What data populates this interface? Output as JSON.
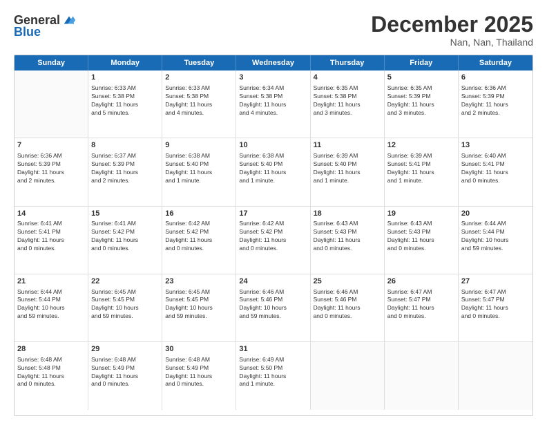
{
  "header": {
    "logo_line1": "General",
    "logo_line2": "Blue",
    "month": "December 2025",
    "location": "Nan, Nan, Thailand"
  },
  "days_of_week": [
    "Sunday",
    "Monday",
    "Tuesday",
    "Wednesday",
    "Thursday",
    "Friday",
    "Saturday"
  ],
  "weeks": [
    [
      {
        "day": "",
        "info": ""
      },
      {
        "day": "1",
        "info": "Sunrise: 6:33 AM\nSunset: 5:38 PM\nDaylight: 11 hours\nand 5 minutes."
      },
      {
        "day": "2",
        "info": "Sunrise: 6:33 AM\nSunset: 5:38 PM\nDaylight: 11 hours\nand 4 minutes."
      },
      {
        "day": "3",
        "info": "Sunrise: 6:34 AM\nSunset: 5:38 PM\nDaylight: 11 hours\nand 4 minutes."
      },
      {
        "day": "4",
        "info": "Sunrise: 6:35 AM\nSunset: 5:38 PM\nDaylight: 11 hours\nand 3 minutes."
      },
      {
        "day": "5",
        "info": "Sunrise: 6:35 AM\nSunset: 5:39 PM\nDaylight: 11 hours\nand 3 minutes."
      },
      {
        "day": "6",
        "info": "Sunrise: 6:36 AM\nSunset: 5:39 PM\nDaylight: 11 hours\nand 2 minutes."
      }
    ],
    [
      {
        "day": "7",
        "info": "Sunrise: 6:36 AM\nSunset: 5:39 PM\nDaylight: 11 hours\nand 2 minutes."
      },
      {
        "day": "8",
        "info": "Sunrise: 6:37 AM\nSunset: 5:39 PM\nDaylight: 11 hours\nand 2 minutes."
      },
      {
        "day": "9",
        "info": "Sunrise: 6:38 AM\nSunset: 5:40 PM\nDaylight: 11 hours\nand 1 minute."
      },
      {
        "day": "10",
        "info": "Sunrise: 6:38 AM\nSunset: 5:40 PM\nDaylight: 11 hours\nand 1 minute."
      },
      {
        "day": "11",
        "info": "Sunrise: 6:39 AM\nSunset: 5:40 PM\nDaylight: 11 hours\nand 1 minute."
      },
      {
        "day": "12",
        "info": "Sunrise: 6:39 AM\nSunset: 5:41 PM\nDaylight: 11 hours\nand 1 minute."
      },
      {
        "day": "13",
        "info": "Sunrise: 6:40 AM\nSunset: 5:41 PM\nDaylight: 11 hours\nand 0 minutes."
      }
    ],
    [
      {
        "day": "14",
        "info": "Sunrise: 6:41 AM\nSunset: 5:41 PM\nDaylight: 11 hours\nand 0 minutes."
      },
      {
        "day": "15",
        "info": "Sunrise: 6:41 AM\nSunset: 5:42 PM\nDaylight: 11 hours\nand 0 minutes."
      },
      {
        "day": "16",
        "info": "Sunrise: 6:42 AM\nSunset: 5:42 PM\nDaylight: 11 hours\nand 0 minutes."
      },
      {
        "day": "17",
        "info": "Sunrise: 6:42 AM\nSunset: 5:42 PM\nDaylight: 11 hours\nand 0 minutes."
      },
      {
        "day": "18",
        "info": "Sunrise: 6:43 AM\nSunset: 5:43 PM\nDaylight: 11 hours\nand 0 minutes."
      },
      {
        "day": "19",
        "info": "Sunrise: 6:43 AM\nSunset: 5:43 PM\nDaylight: 11 hours\nand 0 minutes."
      },
      {
        "day": "20",
        "info": "Sunrise: 6:44 AM\nSunset: 5:44 PM\nDaylight: 10 hours\nand 59 minutes."
      }
    ],
    [
      {
        "day": "21",
        "info": "Sunrise: 6:44 AM\nSunset: 5:44 PM\nDaylight: 10 hours\nand 59 minutes."
      },
      {
        "day": "22",
        "info": "Sunrise: 6:45 AM\nSunset: 5:45 PM\nDaylight: 10 hours\nand 59 minutes."
      },
      {
        "day": "23",
        "info": "Sunrise: 6:45 AM\nSunset: 5:45 PM\nDaylight: 10 hours\nand 59 minutes."
      },
      {
        "day": "24",
        "info": "Sunrise: 6:46 AM\nSunset: 5:46 PM\nDaylight: 10 hours\nand 59 minutes."
      },
      {
        "day": "25",
        "info": "Sunrise: 6:46 AM\nSunset: 5:46 PM\nDaylight: 11 hours\nand 0 minutes."
      },
      {
        "day": "26",
        "info": "Sunrise: 6:47 AM\nSunset: 5:47 PM\nDaylight: 11 hours\nand 0 minutes."
      },
      {
        "day": "27",
        "info": "Sunrise: 6:47 AM\nSunset: 5:47 PM\nDaylight: 11 hours\nand 0 minutes."
      }
    ],
    [
      {
        "day": "28",
        "info": "Sunrise: 6:48 AM\nSunset: 5:48 PM\nDaylight: 11 hours\nand 0 minutes."
      },
      {
        "day": "29",
        "info": "Sunrise: 6:48 AM\nSunset: 5:49 PM\nDaylight: 11 hours\nand 0 minutes."
      },
      {
        "day": "30",
        "info": "Sunrise: 6:48 AM\nSunset: 5:49 PM\nDaylight: 11 hours\nand 0 minutes."
      },
      {
        "day": "31",
        "info": "Sunrise: 6:49 AM\nSunset: 5:50 PM\nDaylight: 11 hours\nand 1 minute."
      },
      {
        "day": "",
        "info": ""
      },
      {
        "day": "",
        "info": ""
      },
      {
        "day": "",
        "info": ""
      }
    ]
  ]
}
